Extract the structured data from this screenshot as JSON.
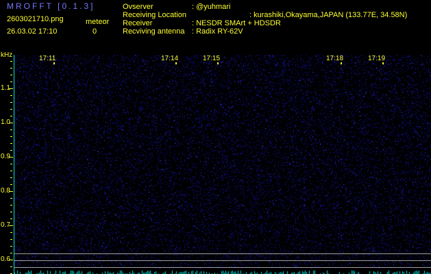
{
  "header": {
    "title": "MROFFT [0.1.3]",
    "filename": "2603021710.png",
    "datetime": "26.03.02 17:10",
    "meteor_label": "meteor",
    "meteor_count": "0"
  },
  "info": [
    {
      "label": "Ovserver",
      "value": ": @yuhmari"
    },
    {
      "label": "Receiving Location",
      "value": ": kurashiki,Okayama,JAPAN (133.77E, 34.58N)"
    },
    {
      "label": "Receiver",
      "value": ": NESDR SMArt + HDSDR"
    },
    {
      "label": "Recviving antenna",
      "value": ": Radix RY-62V"
    }
  ],
  "axis": {
    "unit": "kHz",
    "y_labels": [
      "1.1",
      "1.0",
      "0.9",
      "0.8",
      "0.7",
      "0.6"
    ],
    "time_labels": [
      "17:11",
      "17:14",
      "17:15",
      "17:18",
      "17:19"
    ]
  },
  "colors": {
    "noise": "#2020ff",
    "axis": "#00e0e0",
    "text": "#ffff30"
  }
}
